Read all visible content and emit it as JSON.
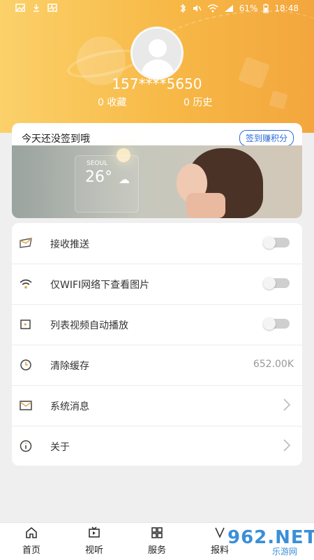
{
  "status_bar": {
    "battery": "61%",
    "time": "18:48"
  },
  "profile": {
    "phone": "157****5650",
    "favorites": "0 收藏",
    "history": "0 历史"
  },
  "signin_card": {
    "title": "今天还没签到哦",
    "earn_button": "签到赚积分"
  },
  "banner": {
    "city": "SEOUL",
    "temperature": "26°"
  },
  "settings": [
    {
      "label": "接收推送",
      "icon": "message-icon",
      "type": "toggle",
      "state": "off"
    },
    {
      "label": "仅WIFI网络下查看图片",
      "icon": "wifi-icon",
      "type": "toggle",
      "state": "off"
    },
    {
      "label": "列表视频自动播放",
      "icon": "video-icon",
      "type": "toggle",
      "state": "off"
    },
    {
      "label": "清除缓存",
      "icon": "cache-icon",
      "type": "value",
      "value": "652.00K"
    },
    {
      "label": "系统消息",
      "icon": "mail-icon",
      "type": "arrow"
    },
    {
      "label": "关于",
      "icon": "info-icon",
      "type": "arrow"
    }
  ],
  "bottom_nav": [
    {
      "label": "首页",
      "icon": "home-icon"
    },
    {
      "label": "视听",
      "icon": "tv-icon"
    },
    {
      "label": "服务",
      "icon": "grid-icon"
    },
    {
      "label": "报料",
      "icon": "report-icon"
    }
  ],
  "watermark": {
    "brand": "962.NET",
    "subtitle": "乐游网"
  },
  "colors": {
    "header_start": "#fbd16a",
    "header_end": "#f3a63d",
    "accent_blue": "#2d6bd9"
  }
}
